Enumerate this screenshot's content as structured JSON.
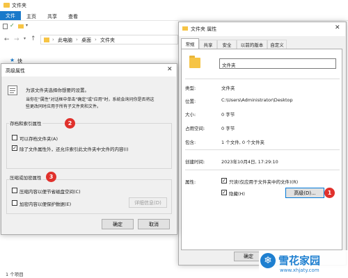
{
  "explorer": {
    "title": "文件夹",
    "ribbon_tabs": [
      "文件",
      "主页",
      "共享",
      "查看"
    ],
    "breadcrumb": [
      "此电脑",
      "桌面",
      "文件夹"
    ],
    "quick_access_label": "快",
    "status_text": "1 个项目"
  },
  "properties": {
    "title": "文件夹 属性",
    "tabs": [
      "常规",
      "共享",
      "安全",
      "以前的版本",
      "自定义"
    ],
    "folder_name": "文件夹",
    "rows": [
      {
        "key": "类型:",
        "value": "文件夹"
      },
      {
        "key": "位置:",
        "value": "C:\\Users\\Administrator\\Desktop"
      },
      {
        "key": "大小:",
        "value": "0 字节"
      },
      {
        "key": "占用空间:",
        "value": "0 字节"
      },
      {
        "key": "包含:",
        "value": "1 个文件, 0 个文件夹"
      },
      {
        "key": "创建时间:",
        "value": "2023年10月4日, 17:29:10"
      }
    ],
    "attributes_label": "属性:",
    "readonly_label": "只读(仅应用于文件夹中的文件)(R)",
    "hidden_label": "隐藏(H)",
    "advanced_button": "高级(D)...",
    "ok_button": "确定",
    "advanced_badge": "1"
  },
  "advanced": {
    "title": "高级属性",
    "intro": "为该文件夹选择你想要的设置。",
    "desc_line1": "当你在\"属性\"对话框中单击\"确定\"或\"应用\"时，系统会询问你是否将这",
    "desc_line2": "些更改同时应用于所有子文件夹和文件。",
    "archive_group": "存档和索引属性",
    "archive_badge": "2",
    "archive_check_label": "可以存档文件夹(A)",
    "index_check_label": "除了文件属性外，还允许索引此文件夹中文件的内容(I)",
    "compress_group": "压缩或加密属性",
    "compress_badge": "3",
    "compress_check_label": "压缩内容以便节省磁盘空间(C)",
    "encrypt_check_label": "加密内容以便保护数据(E)",
    "details_button": "详细信息(D)",
    "ok_button": "确定",
    "cancel_button": "取消"
  },
  "watermark": {
    "text": "雪花家园",
    "url": "www.xhjaty.com"
  },
  "colors": {
    "accent": "#1979ca",
    "badge": "#e0312c",
    "folder": "#f6c445"
  }
}
